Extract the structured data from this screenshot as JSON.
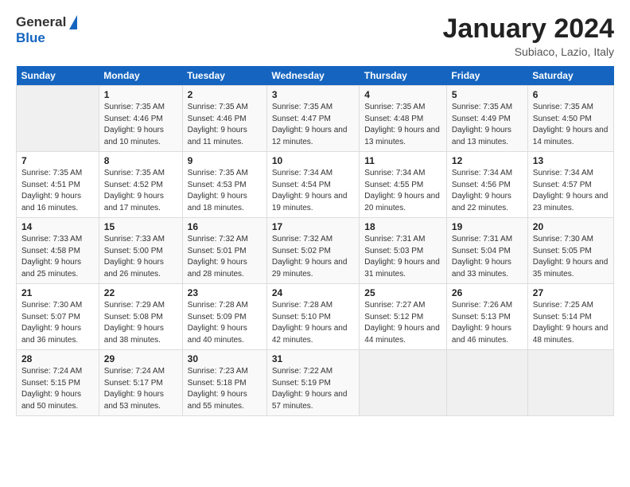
{
  "header": {
    "logo_general": "General",
    "logo_blue": "Blue",
    "cal_title": "January 2024",
    "cal_subtitle": "Subiaco, Lazio, Italy"
  },
  "days_of_week": [
    "Sunday",
    "Monday",
    "Tuesday",
    "Wednesday",
    "Thursday",
    "Friday",
    "Saturday"
  ],
  "weeks": [
    [
      {
        "num": "",
        "empty": true
      },
      {
        "num": "1",
        "sunrise": "Sunrise: 7:35 AM",
        "sunset": "Sunset: 4:46 PM",
        "daylight": "Daylight: 9 hours and 10 minutes."
      },
      {
        "num": "2",
        "sunrise": "Sunrise: 7:35 AM",
        "sunset": "Sunset: 4:46 PM",
        "daylight": "Daylight: 9 hours and 11 minutes."
      },
      {
        "num": "3",
        "sunrise": "Sunrise: 7:35 AM",
        "sunset": "Sunset: 4:47 PM",
        "daylight": "Daylight: 9 hours and 12 minutes."
      },
      {
        "num": "4",
        "sunrise": "Sunrise: 7:35 AM",
        "sunset": "Sunset: 4:48 PM",
        "daylight": "Daylight: 9 hours and 13 minutes."
      },
      {
        "num": "5",
        "sunrise": "Sunrise: 7:35 AM",
        "sunset": "Sunset: 4:49 PM",
        "daylight": "Daylight: 9 hours and 13 minutes."
      },
      {
        "num": "6",
        "sunrise": "Sunrise: 7:35 AM",
        "sunset": "Sunset: 4:50 PM",
        "daylight": "Daylight: 9 hours and 14 minutes."
      }
    ],
    [
      {
        "num": "7",
        "sunrise": "Sunrise: 7:35 AM",
        "sunset": "Sunset: 4:51 PM",
        "daylight": "Daylight: 9 hours and 16 minutes."
      },
      {
        "num": "8",
        "sunrise": "Sunrise: 7:35 AM",
        "sunset": "Sunset: 4:52 PM",
        "daylight": "Daylight: 9 hours and 17 minutes."
      },
      {
        "num": "9",
        "sunrise": "Sunrise: 7:35 AM",
        "sunset": "Sunset: 4:53 PM",
        "daylight": "Daylight: 9 hours and 18 minutes."
      },
      {
        "num": "10",
        "sunrise": "Sunrise: 7:34 AM",
        "sunset": "Sunset: 4:54 PM",
        "daylight": "Daylight: 9 hours and 19 minutes."
      },
      {
        "num": "11",
        "sunrise": "Sunrise: 7:34 AM",
        "sunset": "Sunset: 4:55 PM",
        "daylight": "Daylight: 9 hours and 20 minutes."
      },
      {
        "num": "12",
        "sunrise": "Sunrise: 7:34 AM",
        "sunset": "Sunset: 4:56 PM",
        "daylight": "Daylight: 9 hours and 22 minutes."
      },
      {
        "num": "13",
        "sunrise": "Sunrise: 7:34 AM",
        "sunset": "Sunset: 4:57 PM",
        "daylight": "Daylight: 9 hours and 23 minutes."
      }
    ],
    [
      {
        "num": "14",
        "sunrise": "Sunrise: 7:33 AM",
        "sunset": "Sunset: 4:58 PM",
        "daylight": "Daylight: 9 hours and 25 minutes."
      },
      {
        "num": "15",
        "sunrise": "Sunrise: 7:33 AM",
        "sunset": "Sunset: 5:00 PM",
        "daylight": "Daylight: 9 hours and 26 minutes."
      },
      {
        "num": "16",
        "sunrise": "Sunrise: 7:32 AM",
        "sunset": "Sunset: 5:01 PM",
        "daylight": "Daylight: 9 hours and 28 minutes."
      },
      {
        "num": "17",
        "sunrise": "Sunrise: 7:32 AM",
        "sunset": "Sunset: 5:02 PM",
        "daylight": "Daylight: 9 hours and 29 minutes."
      },
      {
        "num": "18",
        "sunrise": "Sunrise: 7:31 AM",
        "sunset": "Sunset: 5:03 PM",
        "daylight": "Daylight: 9 hours and 31 minutes."
      },
      {
        "num": "19",
        "sunrise": "Sunrise: 7:31 AM",
        "sunset": "Sunset: 5:04 PM",
        "daylight": "Daylight: 9 hours and 33 minutes."
      },
      {
        "num": "20",
        "sunrise": "Sunrise: 7:30 AM",
        "sunset": "Sunset: 5:05 PM",
        "daylight": "Daylight: 9 hours and 35 minutes."
      }
    ],
    [
      {
        "num": "21",
        "sunrise": "Sunrise: 7:30 AM",
        "sunset": "Sunset: 5:07 PM",
        "daylight": "Daylight: 9 hours and 36 minutes."
      },
      {
        "num": "22",
        "sunrise": "Sunrise: 7:29 AM",
        "sunset": "Sunset: 5:08 PM",
        "daylight": "Daylight: 9 hours and 38 minutes."
      },
      {
        "num": "23",
        "sunrise": "Sunrise: 7:28 AM",
        "sunset": "Sunset: 5:09 PM",
        "daylight": "Daylight: 9 hours and 40 minutes."
      },
      {
        "num": "24",
        "sunrise": "Sunrise: 7:28 AM",
        "sunset": "Sunset: 5:10 PM",
        "daylight": "Daylight: 9 hours and 42 minutes."
      },
      {
        "num": "25",
        "sunrise": "Sunrise: 7:27 AM",
        "sunset": "Sunset: 5:12 PM",
        "daylight": "Daylight: 9 hours and 44 minutes."
      },
      {
        "num": "26",
        "sunrise": "Sunrise: 7:26 AM",
        "sunset": "Sunset: 5:13 PM",
        "daylight": "Daylight: 9 hours and 46 minutes."
      },
      {
        "num": "27",
        "sunrise": "Sunrise: 7:25 AM",
        "sunset": "Sunset: 5:14 PM",
        "daylight": "Daylight: 9 hours and 48 minutes."
      }
    ],
    [
      {
        "num": "28",
        "sunrise": "Sunrise: 7:24 AM",
        "sunset": "Sunset: 5:15 PM",
        "daylight": "Daylight: 9 hours and 50 minutes."
      },
      {
        "num": "29",
        "sunrise": "Sunrise: 7:24 AM",
        "sunset": "Sunset: 5:17 PM",
        "daylight": "Daylight: 9 hours and 53 minutes."
      },
      {
        "num": "30",
        "sunrise": "Sunrise: 7:23 AM",
        "sunset": "Sunset: 5:18 PM",
        "daylight": "Daylight: 9 hours and 55 minutes."
      },
      {
        "num": "31",
        "sunrise": "Sunrise: 7:22 AM",
        "sunset": "Sunset: 5:19 PM",
        "daylight": "Daylight: 9 hours and 57 minutes."
      },
      {
        "num": "",
        "empty": true
      },
      {
        "num": "",
        "empty": true
      },
      {
        "num": "",
        "empty": true
      }
    ]
  ]
}
